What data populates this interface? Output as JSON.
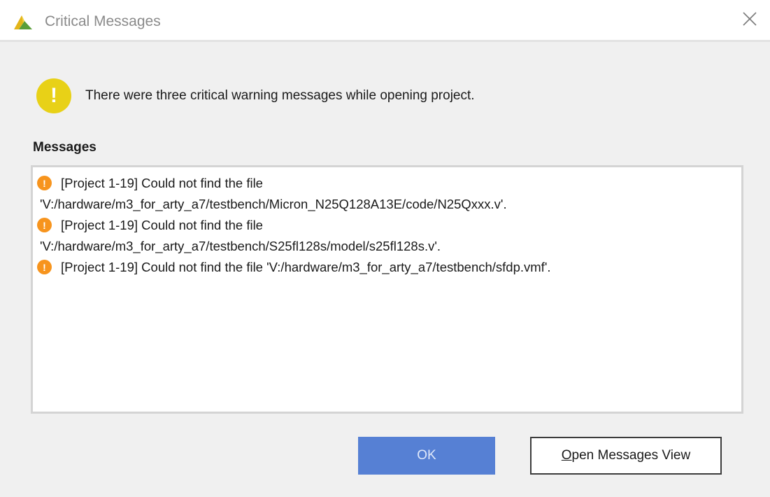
{
  "window": {
    "title": "Critical Messages",
    "logo_icon": "vivado-logo-icon",
    "close_icon": "close-icon"
  },
  "summary": {
    "icon": "warning-icon",
    "icon_glyph": "!",
    "text": "There were three critical warning messages while opening project."
  },
  "messages": {
    "label": "Messages",
    "items": [
      {
        "icon": "critical-warning-icon",
        "line1": "[Project 1-19] Could not find the file",
        "line2": "'V:/hardware/m3_for_arty_a7/testbench/Micron_N25Q128A13E/code/N25Qxxx.v'."
      },
      {
        "icon": "critical-warning-icon",
        "line1": "[Project 1-19] Could not find the file",
        "line2": "'V:/hardware/m3_for_arty_a7/testbench/S25fl128s/model/s25fl128s.v'."
      },
      {
        "icon": "critical-warning-icon",
        "line1": "[Project 1-19] Could not find the file 'V:/hardware/m3_for_arty_a7/testbench/sfdp.vmf'.",
        "line2": ""
      }
    ]
  },
  "buttons": {
    "ok_label": "OK",
    "open_view_mnemonic": "O",
    "open_view_rest": "pen Messages View"
  },
  "colors": {
    "ok_button": "#5680d4",
    "warning_big": "#e8d117",
    "critical_warning": "#f7941d"
  }
}
